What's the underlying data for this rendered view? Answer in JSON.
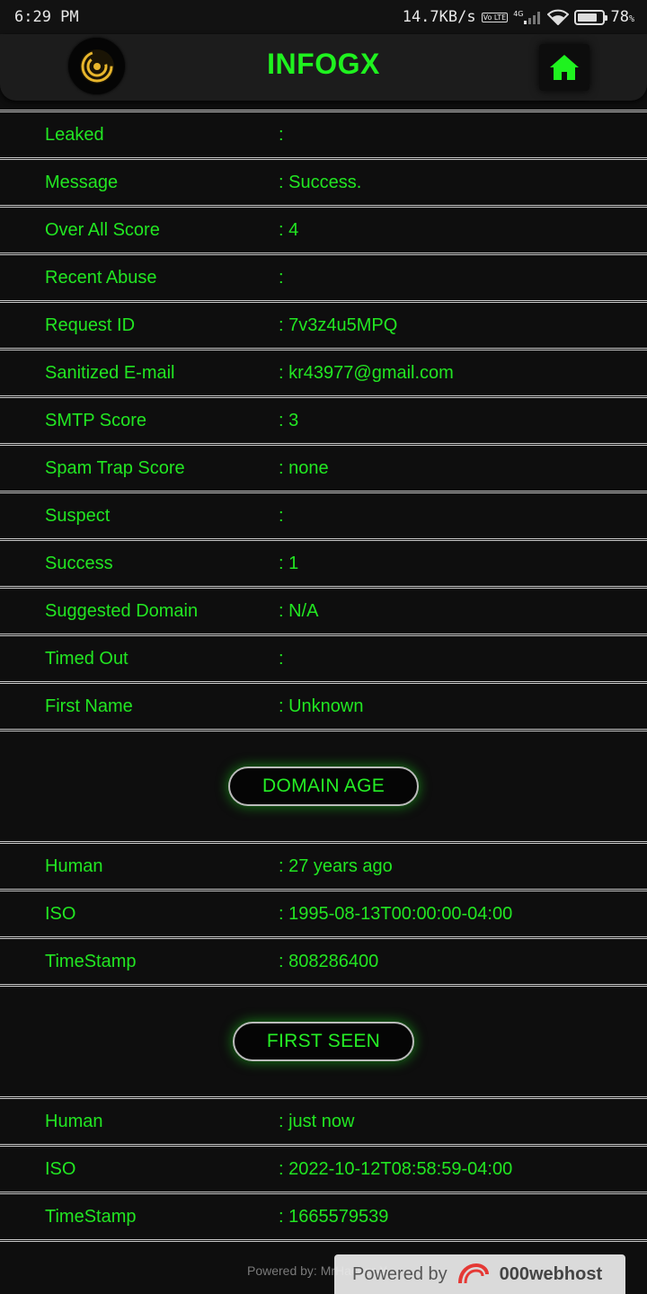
{
  "status_bar": {
    "time": "6:29 PM",
    "net_speed": "14.7KB/s",
    "volte": "Vo LTE",
    "network": "4G",
    "battery": "78",
    "battery_unit": "%",
    "battery_level": 0.78
  },
  "app": {
    "title": "INFOGX",
    "accent_color": "#1ff21f"
  },
  "rows_main": [
    {
      "label": "Leaked",
      "value": ":"
    },
    {
      "label": "Message",
      "value": ": Success."
    },
    {
      "label": "Over All Score",
      "value": ": 4"
    },
    {
      "label": "Recent Abuse",
      "value": ":"
    },
    {
      "label": "Request ID",
      "value": ": 7v3z4u5MPQ"
    },
    {
      "label": "Sanitized E-mail",
      "value": ": kr43977@gmail.com"
    },
    {
      "label": "SMTP Score",
      "value": ": 3"
    },
    {
      "label": "Spam Trap Score",
      "value": ": none"
    },
    {
      "label": "Suspect",
      "value": ":"
    },
    {
      "label": "Success",
      "value": ": 1"
    },
    {
      "label": "Suggested Domain",
      "value": ": N/A"
    },
    {
      "label": "Timed Out",
      "value": ":"
    },
    {
      "label": "First Name",
      "value": ": Unknown"
    }
  ],
  "domain_age": {
    "heading": "DOMAIN AGE",
    "rows": [
      {
        "label": "Human",
        "value": ": 27 years ago"
      },
      {
        "label": "ISO",
        "value": ": 1995-08-13T00:00:00-04:00"
      },
      {
        "label": "TimeStamp",
        "value": ": 808286400"
      }
    ]
  },
  "first_seen": {
    "heading": "FIRST SEEN",
    "rows": [
      {
        "label": "Human",
        "value": ": just now"
      },
      {
        "label": "ISO",
        "value": ": 2022-10-12T08:58:59-04:00"
      },
      {
        "label": "TimeStamp",
        "value": ": 1665579539"
      }
    ]
  },
  "footer": {
    "powered_by": "Powered by: MrHacker-X",
    "webhost_prefix": "Powered by",
    "webhost_brand": "000webhost"
  }
}
